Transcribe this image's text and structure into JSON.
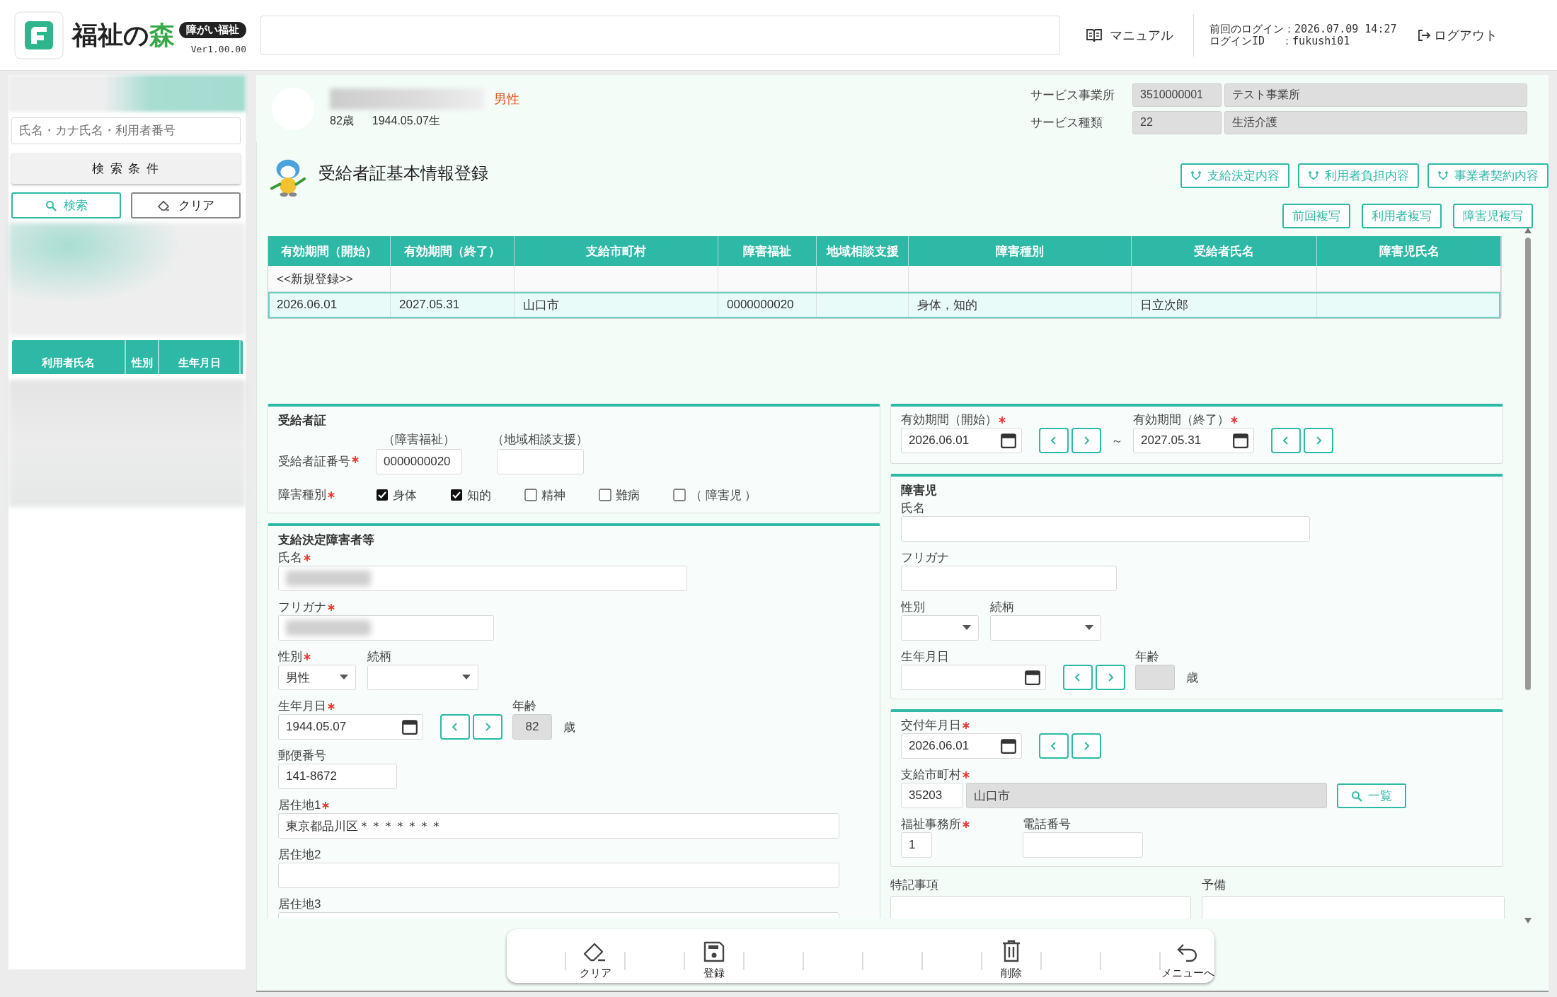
{
  "header": {
    "logo_title": "福祉の",
    "logo_accent": "森",
    "badge": "障がい福祉",
    "version": "Ver1.00.00",
    "manual": "マニュアル",
    "last_login": "前回のログイン：2026.07.09 14:27",
    "login_id": "ログインID　 ：fukushi01",
    "logout": "ログアウト"
  },
  "sidebar": {
    "search_placeholder": "氏名・カナ氏名・利用者番号",
    "conditions_button": "検 索 条 件",
    "search_button": "検索",
    "clear_button": "クリア",
    "list_columns": [
      "利用者氏名",
      "性別",
      "生年月日"
    ]
  },
  "patient": {
    "gender": "男性",
    "age": "82歳",
    "birth": "1944.05.07生",
    "office_label": "サービス事業所",
    "office_code": "3510000001",
    "office_name": "テスト事業所",
    "service_label": "サービス種類",
    "service_code": "22",
    "service_name": "生活介護"
  },
  "heading": {
    "title": "受給者証基本情報登録",
    "link_buttons": [
      "支給決定内容",
      "利用者負担内容",
      "事業者契約内容"
    ],
    "copy_buttons": [
      "前回複写",
      "利用者複写",
      "障害児複写"
    ]
  },
  "table": {
    "columns": [
      "有効期間（開始）",
      "有効期間（終了）",
      "支給市町村",
      "障害福祉",
      "地域相談支援",
      "障害種別",
      "受給者氏名",
      "障害児氏名"
    ],
    "rows": [
      {
        "selected": false,
        "cells": [
          "<<新規登録>>",
          null,
          null,
          null,
          null,
          null,
          null,
          null
        ]
      },
      {
        "selected": true,
        "cells": [
          "2026.06.01",
          "2027.05.31",
          "山口市",
          "0000000020",
          null,
          "身体，知的",
          "日立次郎",
          null
        ]
      }
    ]
  },
  "certificate": {
    "title": "受給者証",
    "number": {
      "label": "受給者証番号",
      "required": true
    },
    "welfare_caption": "（障害福祉）",
    "welfare_value": "0000000020",
    "consult_caption": "（地域相談支援）",
    "types_field": {
      "label": "障害種別",
      "required": true
    },
    "types": [
      {
        "label": "身体",
        "checked": true
      },
      {
        "label": "知的",
        "checked": true
      },
      {
        "label": "精神",
        "checked": false
      },
      {
        "label": "難病",
        "checked": false
      },
      {
        "label": "（ 障害児 ）",
        "checked": false
      }
    ]
  },
  "decided_person": {
    "title": "支給決定障害者等",
    "name": {
      "label": "氏名",
      "required": true,
      "blurred": true
    },
    "kana": {
      "label": "フリガナ",
      "required": true,
      "blurred": true
    },
    "gender": {
      "label": "性別",
      "required": true,
      "value": "男性"
    },
    "relation": {
      "label": "続柄",
      "required": false
    },
    "birth": {
      "label": "生年月日",
      "required": true,
      "value": "1944.05.07"
    },
    "age": {
      "label": "年齢",
      "value": "82",
      "unit": "歳"
    },
    "postal": {
      "label": "郵便番号",
      "required": false,
      "value": "141-8672"
    },
    "address1": {
      "label": "居住地1",
      "required": true,
      "value": "東京都品川区＊＊＊＊＊＊＊"
    },
    "address2": {
      "label": "居住地2",
      "required": false
    },
    "address3": {
      "label": "居住地3",
      "required": false
    }
  },
  "validity": {
    "start": {
      "label": "有効期間（開始）",
      "required": true,
      "value": "2026.06.01"
    },
    "tilde": "～",
    "end": {
      "label": "有効期間（終了）",
      "required": true,
      "value": "2027.05.31"
    }
  },
  "disabled_child": {
    "title": "障害児",
    "name": {
      "label": "氏名",
      "required": false
    },
    "kana": {
      "label": "フリガナ",
      "required": false
    },
    "gender": {
      "label": "性別",
      "required": false
    },
    "relation": {
      "label": "続柄",
      "required": false
    },
    "birth": {
      "label": "生年月日",
      "required": false
    },
    "age": {
      "label": "年齢",
      "unit": "歳"
    }
  },
  "issue": {
    "date": {
      "label": "交付年月日",
      "required": true,
      "value": "2026.06.01"
    },
    "city": {
      "label": "支給市町村",
      "required": true,
      "code": "35203",
      "name": "山口市"
    },
    "list_button": "一覧",
    "office": {
      "label": "福祉事務所",
      "required": true,
      "value": "1"
    },
    "phone": {
      "label": "電話番号",
      "required": false
    }
  },
  "notes": {
    "special_label": "特記事項",
    "reserve_label": "予備"
  },
  "toolbar": [
    {
      "kind": "eraser",
      "label": "クリア"
    },
    {
      "kind": "save",
      "label": "登録"
    },
    {
      "kind": "trash",
      "label": "削除"
    },
    {
      "kind": "undo",
      "label": "メニューへ"
    }
  ]
}
